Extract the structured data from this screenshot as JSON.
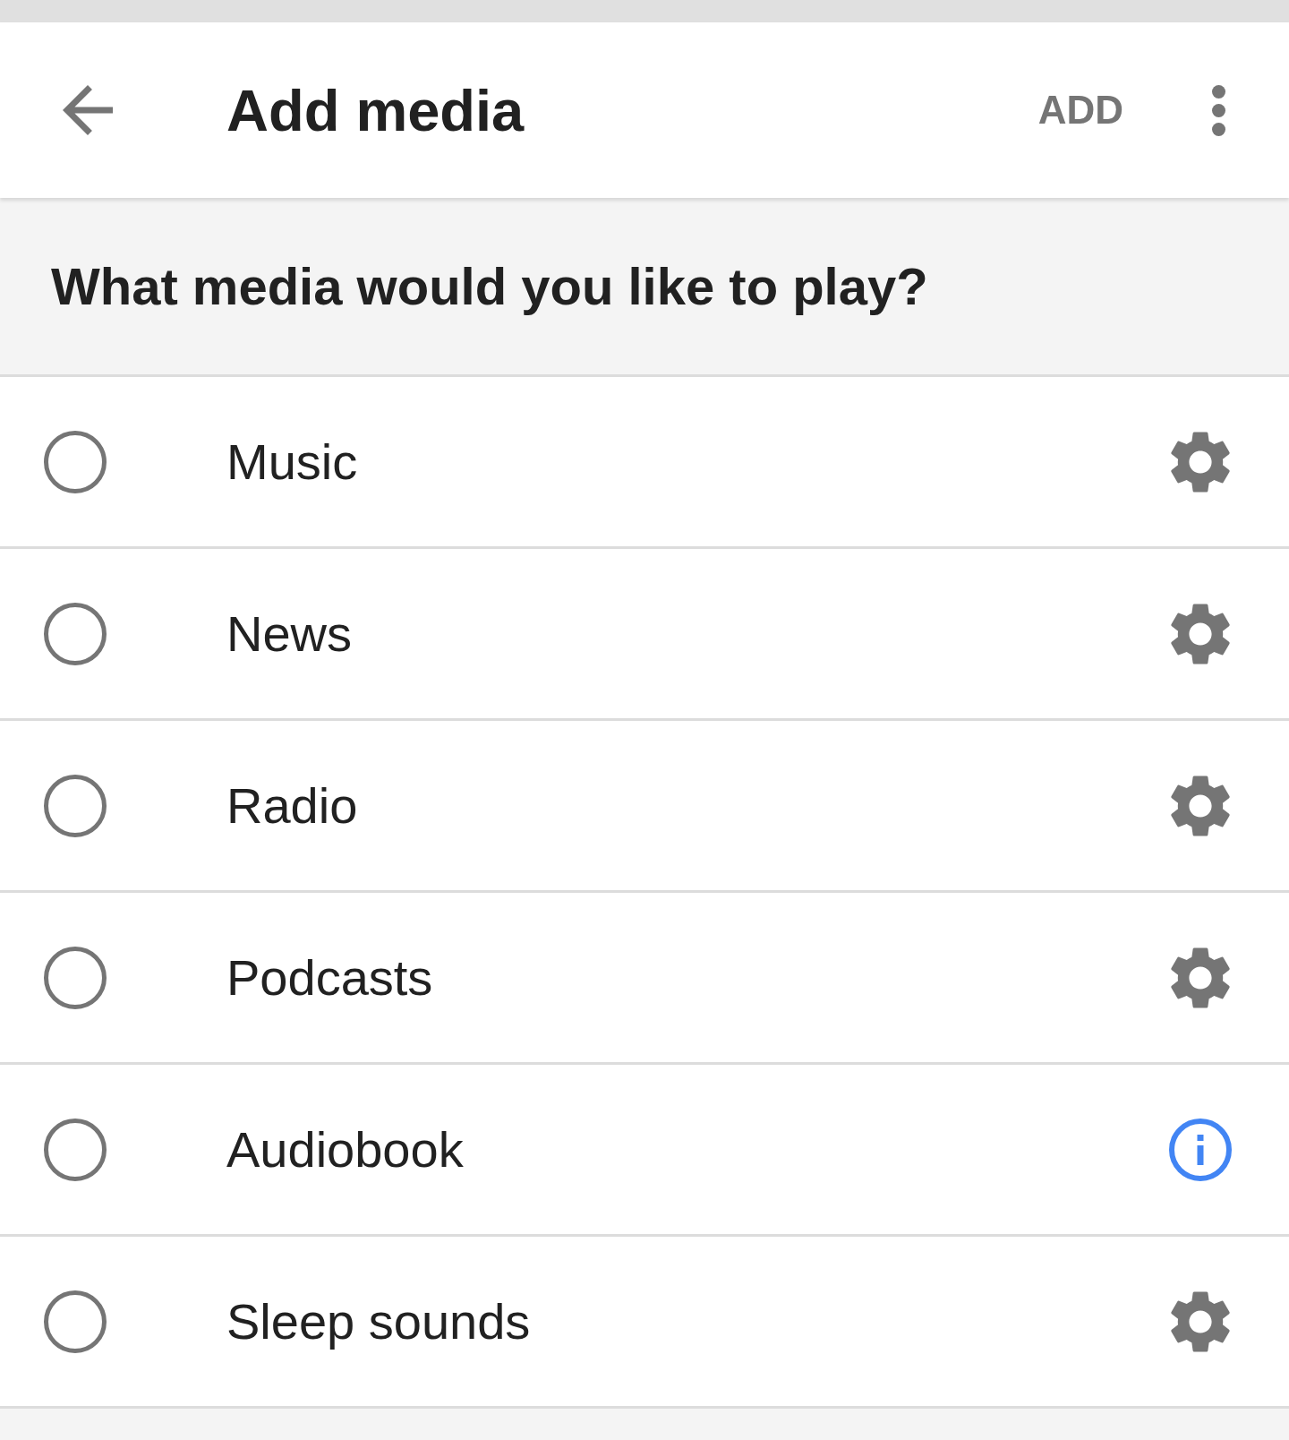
{
  "app_bar": {
    "title": "Add media",
    "action": "ADD"
  },
  "question": "What media would you like to play?",
  "items": [
    {
      "label": "Music",
      "selected": false,
      "kind": "settings"
    },
    {
      "label": "News",
      "selected": false,
      "kind": "settings"
    },
    {
      "label": "Radio",
      "selected": false,
      "kind": "settings"
    },
    {
      "label": "Podcasts",
      "selected": false,
      "kind": "settings"
    },
    {
      "label": "Audiobook",
      "selected": false,
      "kind": "info"
    },
    {
      "label": "Sleep sounds",
      "selected": false,
      "kind": "settings"
    }
  ]
}
